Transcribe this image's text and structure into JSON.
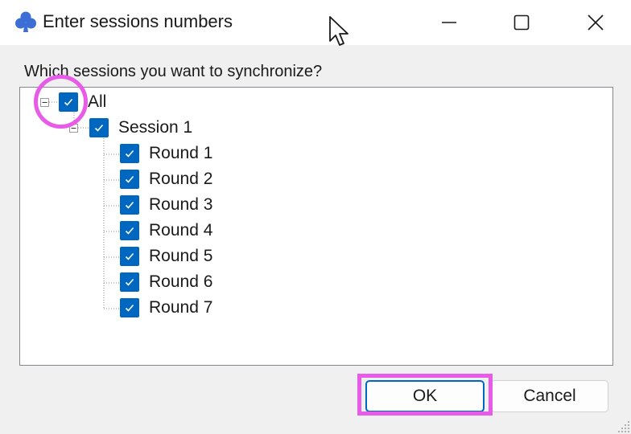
{
  "window": {
    "title": "Enter sessions numbers",
    "app_icon": "club-icon",
    "controls": [
      "minimize-icon",
      "maximize-icon",
      "close-icon"
    ]
  },
  "prompt": "Which sessions you want to synchronize?",
  "tree": {
    "root": {
      "label": "All",
      "checked": true,
      "expanded": true
    },
    "session": {
      "label": "Session 1",
      "checked": true,
      "expanded": true
    },
    "rounds": [
      {
        "label": "Round 1",
        "checked": true
      },
      {
        "label": "Round 2",
        "checked": true
      },
      {
        "label": "Round 3",
        "checked": true
      },
      {
        "label": "Round 4",
        "checked": true
      },
      {
        "label": "Round 5",
        "checked": true
      },
      {
        "label": "Round 6",
        "checked": true
      },
      {
        "label": "Round 7",
        "checked": true
      }
    ]
  },
  "buttons": {
    "ok": "OK",
    "cancel": "Cancel"
  },
  "colors": {
    "accent": "#0067c0",
    "highlight": "#e85ae8",
    "background": "#f0f0f0"
  }
}
